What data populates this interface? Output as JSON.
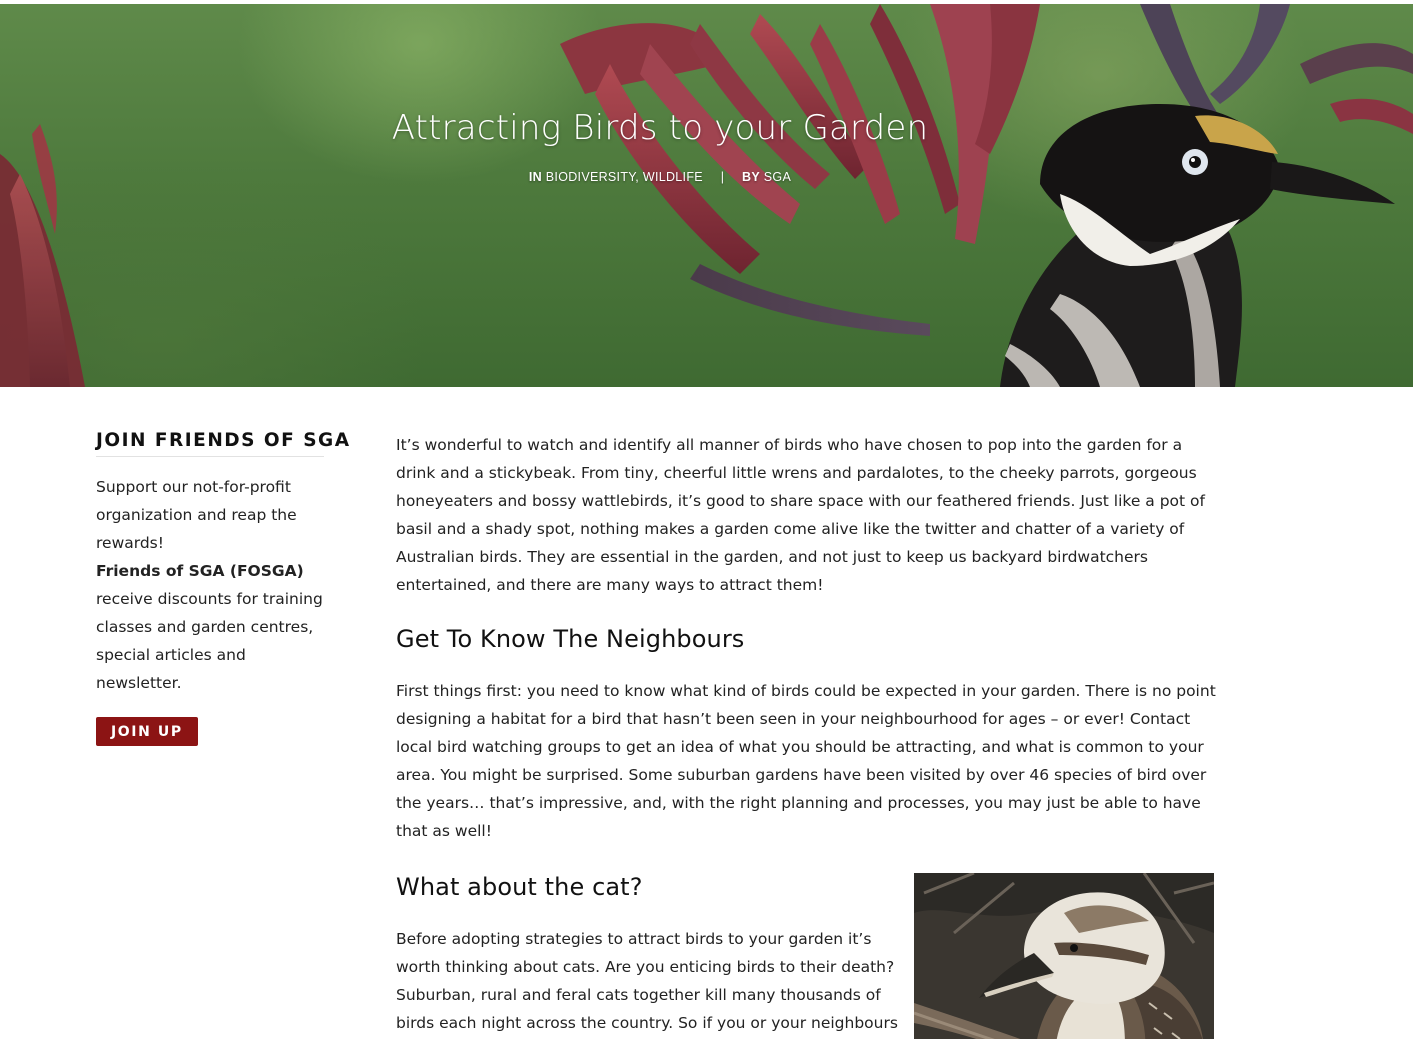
{
  "hero": {
    "title": "Attracting Birds to your Garden",
    "in_label": "IN",
    "categories": [
      "BIODIVERSITY",
      "WILDLIFE"
    ],
    "category_sep": ",",
    "separator": "|",
    "by_label": "BY",
    "author": "SGA"
  },
  "sidebar": {
    "widget_title": "JOIN FRIENDS OF SGA",
    "intro": "Support our not-for-profit organization and reap the rewards!",
    "friends_bold": "Friends of SGA (FOSGA)",
    "friends_rest": "receive discounts for training classes and garden centres, special articles and newsletter.",
    "button_label": "JOIN UP",
    "button_color": "#8c1414"
  },
  "article": {
    "intro": "It’s wonderful to watch and identify all manner of birds who have chosen to pop into the garden for a drink and a stickybeak. From tiny, cheerful little wrens and pardalotes, to the cheeky parrots, gorgeous honeyeaters and bossy wattlebirds, it’s good to share space with our feathered friends. Just like a pot of basil and a shady spot, nothing makes a garden come alive like the twitter and chatter of a variety of Australian birds. They are essential in the garden, and not just to keep us backyard birdwatchers entertained, and there are many ways to attract them!",
    "heading_neighbours": "Get To Know The Neighbours",
    "neighbours_text": "First things first: you need to know what kind of birds could be expected in your garden.  There is no point designing a habitat for a bird that hasn’t been seen in your neighbourhood for ages – or ever! Contact local bird watching groups to get an idea of what you should be attracting, and what is common to your area. You might be surprised.  Some suburban gardens have been visited by over 46 species of bird over the years… that’s impressive, and, with the right planning and processes, you may just be able to have that as well!",
    "heading_cat": "What about the cat?",
    "cat_text": "Before adopting strategies to attract birds to your garden it’s worth thinking about cats. Are you enticing birds to their death? Suburban, rural and feral cats together kill many thousands of birds each night across the country. So if you or your neighbours own cats some thought is required."
  }
}
